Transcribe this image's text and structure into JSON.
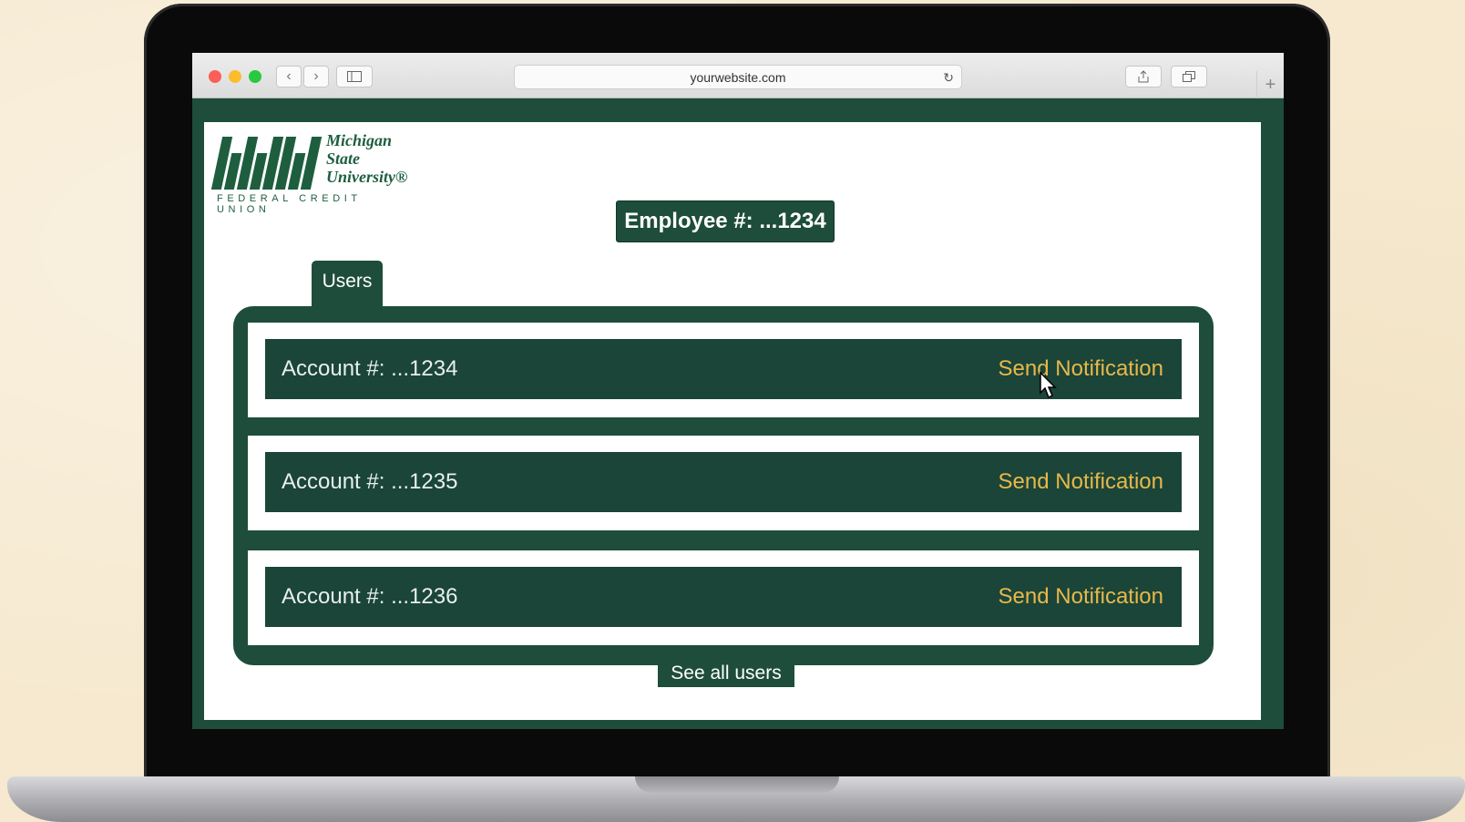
{
  "browser": {
    "url": "yourwebsite.com",
    "back_icon": "chevron-left-icon",
    "forward_icon": "chevron-right-icon",
    "sidebar_icon": "sidebar-icon",
    "reload_icon": "reload-icon",
    "share_icon": "share-icon",
    "tabs_icon": "tabs-icon",
    "new_tab_icon": "plus-icon"
  },
  "logo": {
    "line1": "Michigan",
    "line2": "State",
    "line3": "University®",
    "subtitle": "FEDERAL CREDIT UNION"
  },
  "header": {
    "employee": "Employee #: ...1234"
  },
  "tabs": {
    "users": "Users"
  },
  "accounts": [
    {
      "label": "Account #: ...1234",
      "action": "Send Notification"
    },
    {
      "label": "Account #: ...1235",
      "action": "Send Notification"
    },
    {
      "label": "Account #: ...1236",
      "action": "Send Notification"
    }
  ],
  "footer": {
    "see_all": "See all users"
  },
  "colors": {
    "brand_green": "#1e4d3b",
    "row_green": "#1a4538",
    "action_gold": "#e8b84a"
  }
}
